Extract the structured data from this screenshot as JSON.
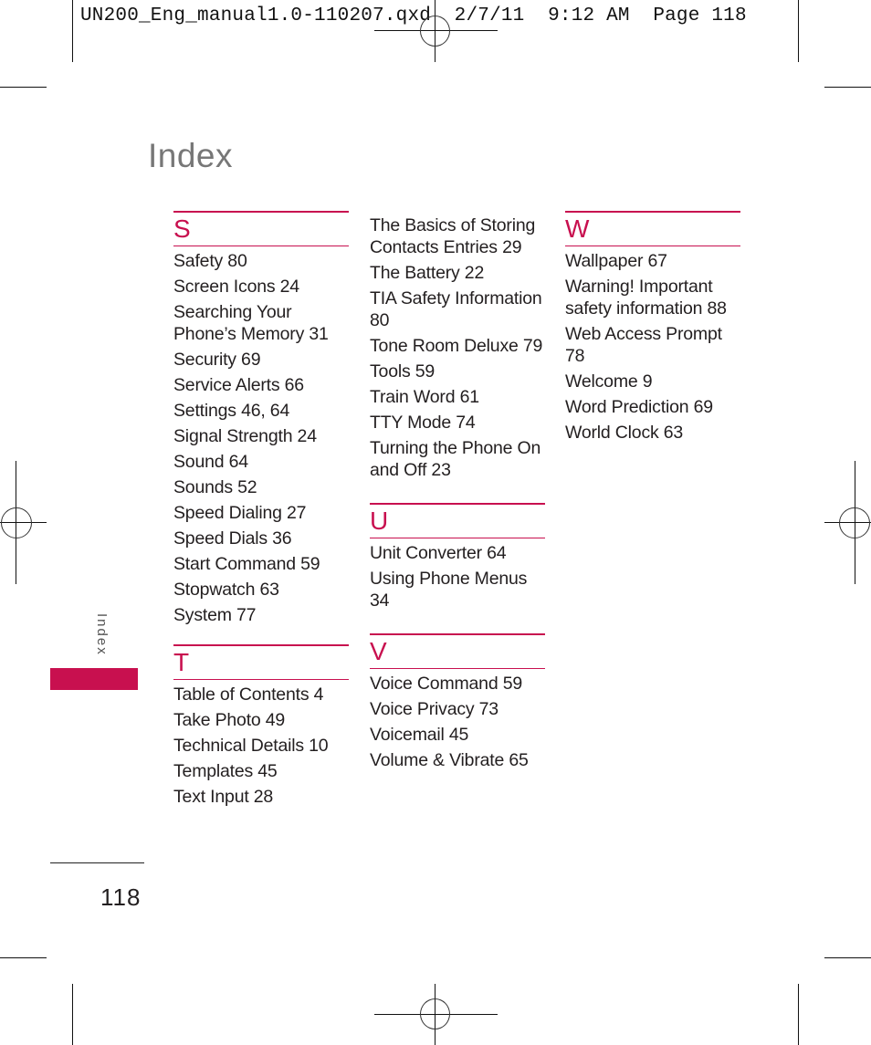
{
  "slug": {
    "filename": "UN200_Eng_manual1.0-110207.qxd",
    "date": "2/7/11",
    "time": "9:12 AM",
    "page_label": "Page 118"
  },
  "title": "Index",
  "side_tab_label": "Index",
  "page_number": "118",
  "accent_color": "#c8104f",
  "columns": [
    {
      "lead_entries": [],
      "sections": [
        {
          "letter": "S",
          "entries": [
            "Safety 80",
            "Screen Icons 24",
            "Searching Your Phone’s Memory 31",
            "Security 69",
            "Service Alerts 66",
            "Settings 46, 64",
            "Signal Strength 24",
            "Sound 64",
            "Sounds 52",
            "Speed Dialing 27",
            "Speed Dials 36",
            "Start Command 59",
            "Stopwatch 63",
            "System 77"
          ]
        },
        {
          "letter": "T",
          "entries": [
            "Table of Contents 4",
            "Take Photo 49",
            "Technical Details 10",
            "Templates 45",
            "Text Input 28"
          ]
        }
      ]
    },
    {
      "lead_entries": [
        "The Basics of Storing Contacts Entries 29",
        "The Battery 22",
        "TIA Safety Information 80",
        "Tone Room Deluxe 79",
        "Tools 59",
        "Train Word 61",
        "TTY Mode 74",
        "Turning the Phone On and Off 23"
      ],
      "sections": [
        {
          "letter": "U",
          "entries": [
            "Unit Converter 64",
            "Using Phone Menus 34"
          ]
        },
        {
          "letter": "V",
          "entries": [
            "Voice Command 59",
            "Voice Privacy 73",
            "Voicemail 45",
            "Volume & Vibrate 65"
          ]
        }
      ]
    },
    {
      "lead_entries": [],
      "sections": [
        {
          "letter": "W",
          "entries": [
            "Wallpaper 67",
            "Warning! Important safety information 88",
            "Web Access Prompt 78",
            "Welcome 9",
            "Word Prediction 69",
            "World Clock 63"
          ]
        }
      ]
    }
  ]
}
